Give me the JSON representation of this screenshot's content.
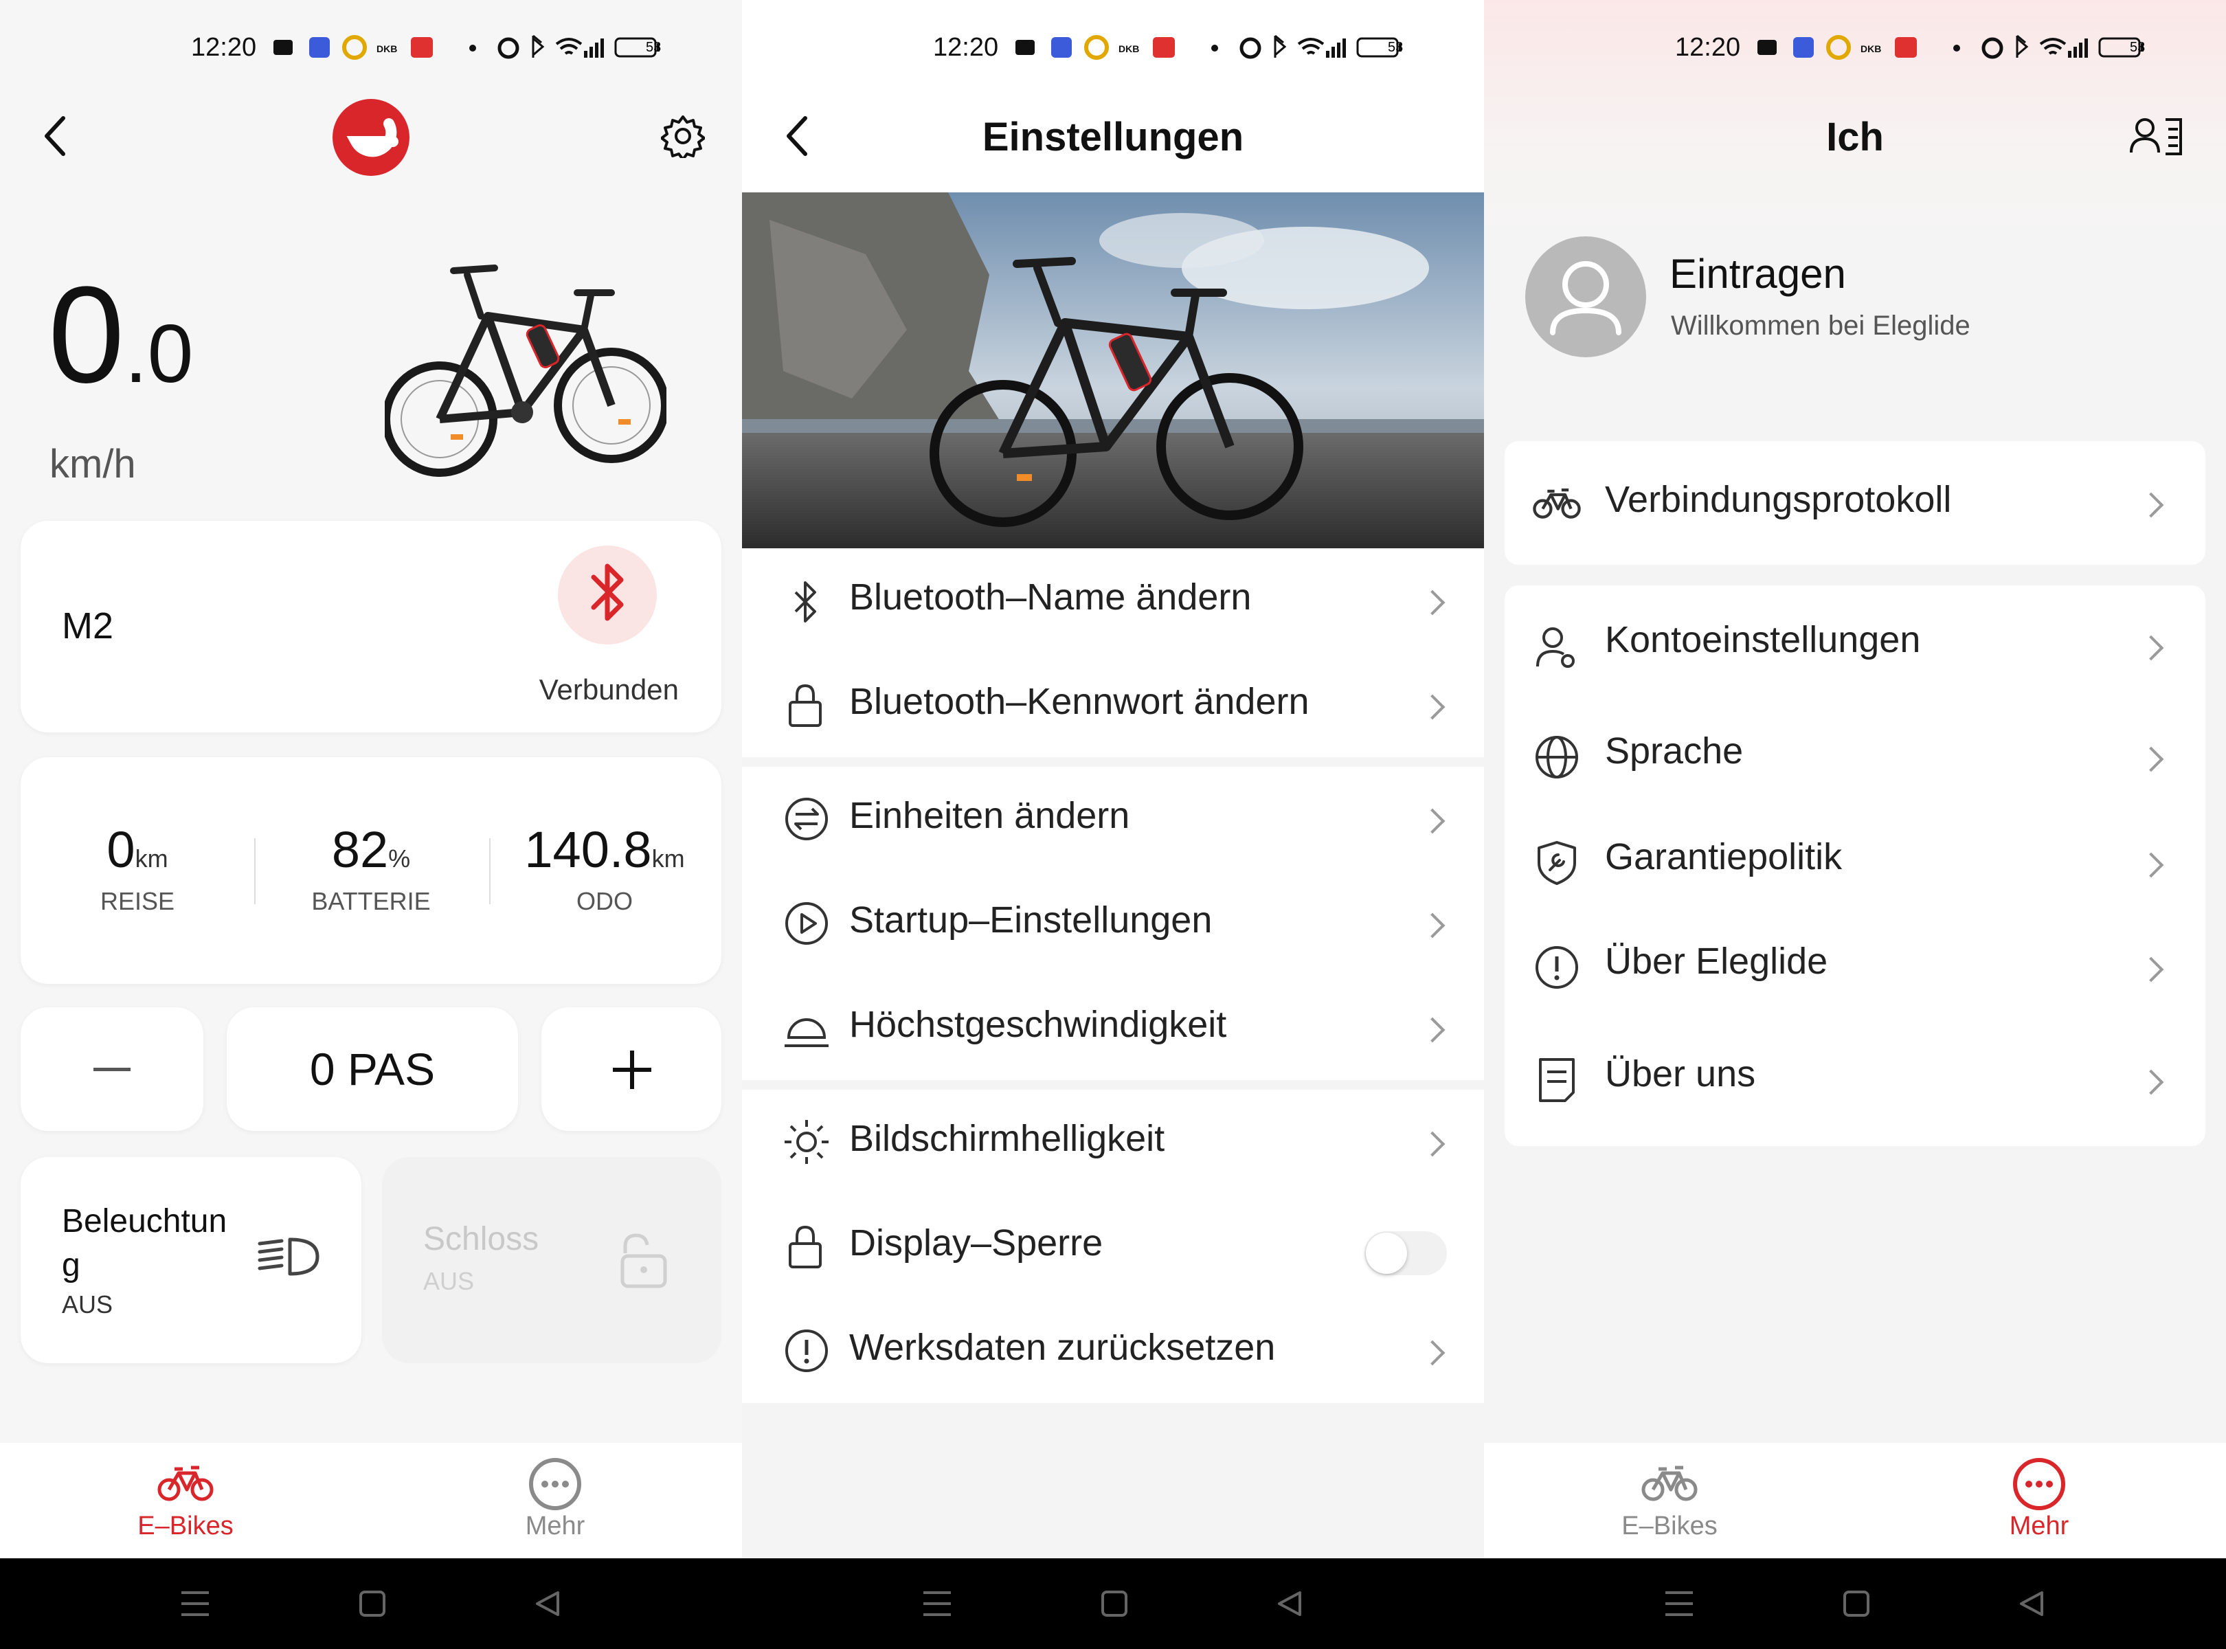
{
  "status": {
    "time": "12:20",
    "battery": "53",
    "dkb": "DKB"
  },
  "home": {
    "speed_int": "0",
    "speed_dec": ".0",
    "speed_unit": "km/h",
    "bike_model": "M2",
    "connection_status": "Verbunden",
    "stats": [
      {
        "value": "0",
        "unit": "km",
        "label": "REISE"
      },
      {
        "value": "82",
        "unit": "%",
        "label": "BATTERIE"
      },
      {
        "value": "140.8",
        "unit": "km",
        "label": "ODO"
      }
    ],
    "pas_minus": "—",
    "pas_value": "0 PAS",
    "pas_plus": "+",
    "light_title_1": "Beleuchtun",
    "light_title_2": "g",
    "light_state": "AUS",
    "lock_title": "Schloss",
    "lock_state": "AUS"
  },
  "settings": {
    "title": "Einstellungen",
    "group1": [
      {
        "label": "Bluetooth–Name ändern",
        "icon": "bluetooth-icon"
      },
      {
        "label": "Bluetooth–Kennwort ändern",
        "icon": "lock-icon"
      }
    ],
    "group2": [
      {
        "label": "Einheiten ändern",
        "icon": "units-swap-icon"
      },
      {
        "label": "Startup–Einstellungen",
        "icon": "play-circle-icon"
      },
      {
        "label": "Höchstgeschwindigkeit",
        "icon": "speed-dome-icon"
      }
    ],
    "group3": [
      {
        "label": "Bildschirmhelligkeit",
        "icon": "sun-icon"
      },
      {
        "label": "Display–Sperre",
        "icon": "lock-icon",
        "toggle": false
      },
      {
        "label": "Werksdaten zurücksetzen",
        "icon": "alert-circle-icon"
      }
    ]
  },
  "me": {
    "title": "Ich",
    "login_title": "Eintragen",
    "login_subtitle": "Willkommen bei Eleglide",
    "card1": [
      {
        "label": "Verbindungsprotokoll",
        "icon": "bike-icon"
      }
    ],
    "card2": [
      {
        "label": "Kontoeinstellungen",
        "icon": "user-gear-icon"
      },
      {
        "label": "Sprache",
        "icon": "globe-icon"
      },
      {
        "label": "Garantiepolitik",
        "icon": "shield-wrench-icon"
      },
      {
        "label": "Über Eleglide",
        "icon": "alert-circle-icon"
      },
      {
        "label": "Über uns",
        "icon": "document-icon"
      }
    ]
  },
  "tabs": [
    {
      "label": "E–Bikes"
    },
    {
      "label": "Mehr"
    }
  ],
  "colors": {
    "accent": "#d8262b",
    "inactive": "#8a8a8a",
    "text": "#111111"
  }
}
